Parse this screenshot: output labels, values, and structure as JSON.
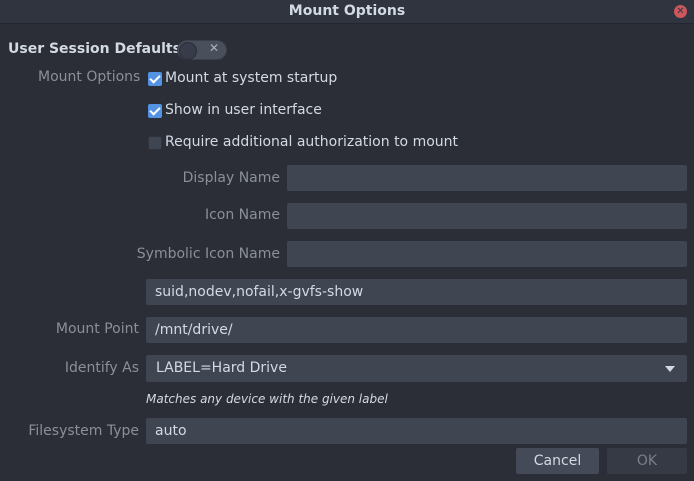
{
  "window": {
    "title": "Mount Options"
  },
  "session": {
    "label": "User Session Defaults",
    "toggle_on": false,
    "toggle_glyph": "✕"
  },
  "mount_options": {
    "label": "Mount Options",
    "checkboxes": [
      {
        "label": "Mount at system startup",
        "checked": true
      },
      {
        "label": "Show in user interface",
        "checked": true
      },
      {
        "label": "Require additional authorization to mount",
        "checked": false
      }
    ]
  },
  "fields": {
    "display_name": {
      "label": "Display Name",
      "value": ""
    },
    "icon_name": {
      "label": "Icon Name",
      "value": ""
    },
    "symbolic_icon_name": {
      "label": "Symbolic Icon Name",
      "value": ""
    },
    "options": {
      "value": "suid,nodev,nofail,x-gvfs-show"
    },
    "mount_point": {
      "label": "Mount Point",
      "value": "/mnt/drive/"
    },
    "identify_as": {
      "label": "Identify As",
      "value": "LABEL=Hard Drive",
      "hint": "Matches any device with the given label"
    },
    "filesystem_type": {
      "label": "Filesystem Type",
      "value": "auto"
    }
  },
  "buttons": {
    "cancel": "Cancel",
    "ok": "OK"
  },
  "colors": {
    "accent": "#5294e2",
    "close": "#cc575d",
    "background": "#2b2e37"
  },
  "icons": {
    "close": "close-icon",
    "dropdown": "chevron-down-icon",
    "check": "checkmark-icon"
  }
}
